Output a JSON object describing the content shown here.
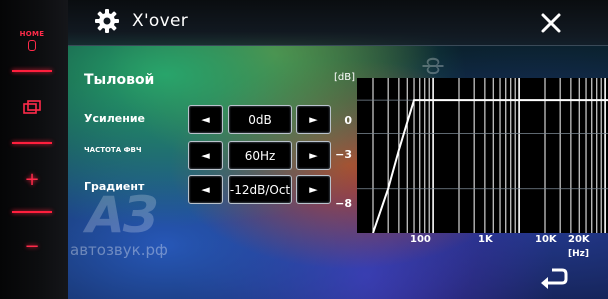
{
  "bezel": {
    "home_label": "HOME",
    "accent": "#ff1f3d",
    "icons": [
      "mic-icon",
      "window-icon",
      "plus-icon",
      "minus-icon"
    ]
  },
  "header": {
    "title": "X'over",
    "icons": {
      "settings": "gear-icon",
      "close": "close-icon"
    }
  },
  "section": {
    "title": "Тыловой"
  },
  "rows": {
    "gain": {
      "label": "Усиление",
      "value": "0dB"
    },
    "freq": {
      "label": "ЧАСТОТА ФВЧ",
      "value": "60Hz"
    },
    "slope": {
      "label": "Градиент",
      "value": "-12dB/Oct"
    }
  },
  "arrows": {
    "left": "◄",
    "right": "►"
  },
  "graph": {
    "db_unit": "[dB]",
    "db_labels": [
      "0",
      "−3",
      "−8"
    ],
    "hz_labels": [
      "100",
      "1K",
      "10K",
      "20K"
    ],
    "hz_unit": "[Hz]"
  },
  "chart_data": {
    "type": "line",
    "title": "",
    "xlabel": "[Hz]",
    "ylabel": "[dB]",
    "x_scale": "log",
    "xlim": [
      20,
      20000
    ],
    "ylim": [
      -12,
      2
    ],
    "x_ticks": [
      100,
      1000,
      10000,
      20000
    ],
    "y_ticks": [
      0,
      -3,
      -8
    ],
    "grid": true,
    "series": [
      {
        "x": [
          20,
          30,
          40,
          50,
          60,
          100,
          1000,
          10000,
          20000
        ],
        "y": [
          -12,
          -8,
          -4.5,
          -2,
          0,
          0,
          0,
          0,
          0
        ]
      }
    ],
    "line_color": "#ffffff",
    "grid_color": "#ffffff",
    "background": "#000000"
  },
  "footer": {
    "icons": {
      "back": "return-icon"
    }
  },
  "watermark": {
    "logo": "АЗ",
    "text": "автозвук.рф"
  }
}
